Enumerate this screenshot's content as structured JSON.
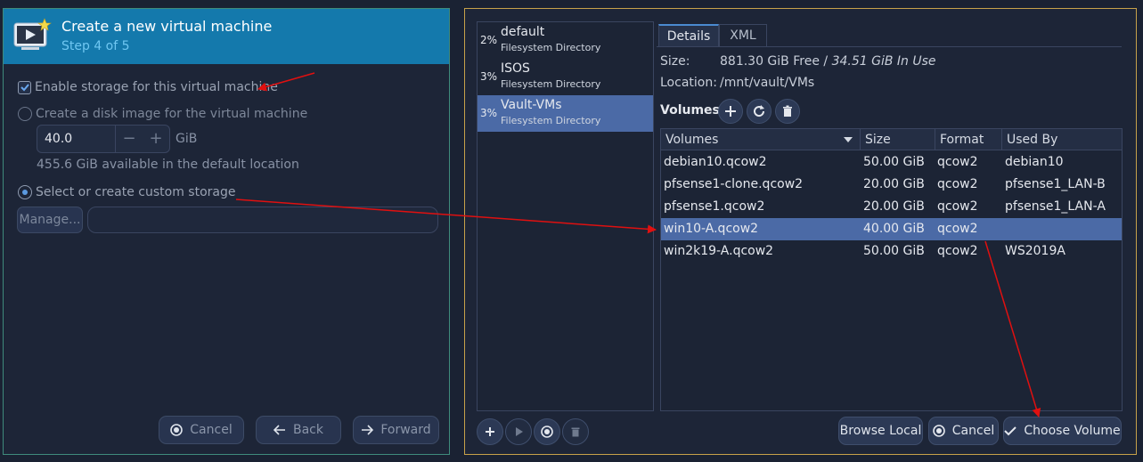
{
  "wizard": {
    "title": "Create a new virtual machine",
    "step": "Step 4 of 5",
    "enable_storage_label": "Enable storage for this virtual machine",
    "create_disk_label": "Create a disk image for the virtual machine",
    "disk_size_value": "40.0",
    "disk_minus": "−",
    "disk_plus": "+",
    "disk_unit": "GiB",
    "available_text": "455.6 GiB available in the default location",
    "custom_storage_label": "Select or create custom storage",
    "manage_label": "Manage...",
    "path_value": "",
    "cancel_label": "Cancel",
    "back_label": "Back",
    "forward_label": "Forward"
  },
  "storage": {
    "pools": [
      {
        "pct": "2%",
        "name": "default",
        "type": "Filesystem Directory"
      },
      {
        "pct": "3%",
        "name": "ISOS",
        "type": "Filesystem Directory"
      },
      {
        "pct": "3%",
        "name": "Vault-VMs",
        "type": "Filesystem Directory"
      }
    ],
    "tabs": {
      "details": "Details",
      "xml": "XML"
    },
    "size_label": "Size:",
    "size_free": "881.30 GiB Free / ",
    "size_inuse": "34.51 GiB In Use",
    "location_label": "Location:",
    "location_value": "/mnt/vault/VMs",
    "volumes_title": "Volumes",
    "table_headers": {
      "volumes": "Volumes",
      "size": "Size",
      "format": "Format",
      "used_by": "Used By"
    },
    "volumes": [
      {
        "name": "debian10.qcow2",
        "size": "50.00 GiB",
        "format": "qcow2",
        "used_by": "debian10"
      },
      {
        "name": "pfsense1-clone.qcow2",
        "size": "20.00 GiB",
        "format": "qcow2",
        "used_by": "pfsense1_LAN-B"
      },
      {
        "name": "pfsense1.qcow2",
        "size": "20.00 GiB",
        "format": "qcow2",
        "used_by": "pfsense1_LAN-A"
      },
      {
        "name": "win10-A.qcow2",
        "size": "40.00 GiB",
        "format": "qcow2",
        "used_by": ""
      },
      {
        "name": "win2k19-A.qcow2",
        "size": "50.00 GiB",
        "format": "qcow2",
        "used_by": "WS2019A"
      }
    ],
    "browse_local_label": "Browse Local",
    "cancel_label": "Cancel",
    "choose_volume_label": "Choose Volume"
  },
  "colors": {
    "header_blue": "#1479ac",
    "selection": "#4b6aa6",
    "annotation_arrow": "#e01010",
    "storage_border": "#c7a24a",
    "wizard_border": "#3f8b7c"
  }
}
